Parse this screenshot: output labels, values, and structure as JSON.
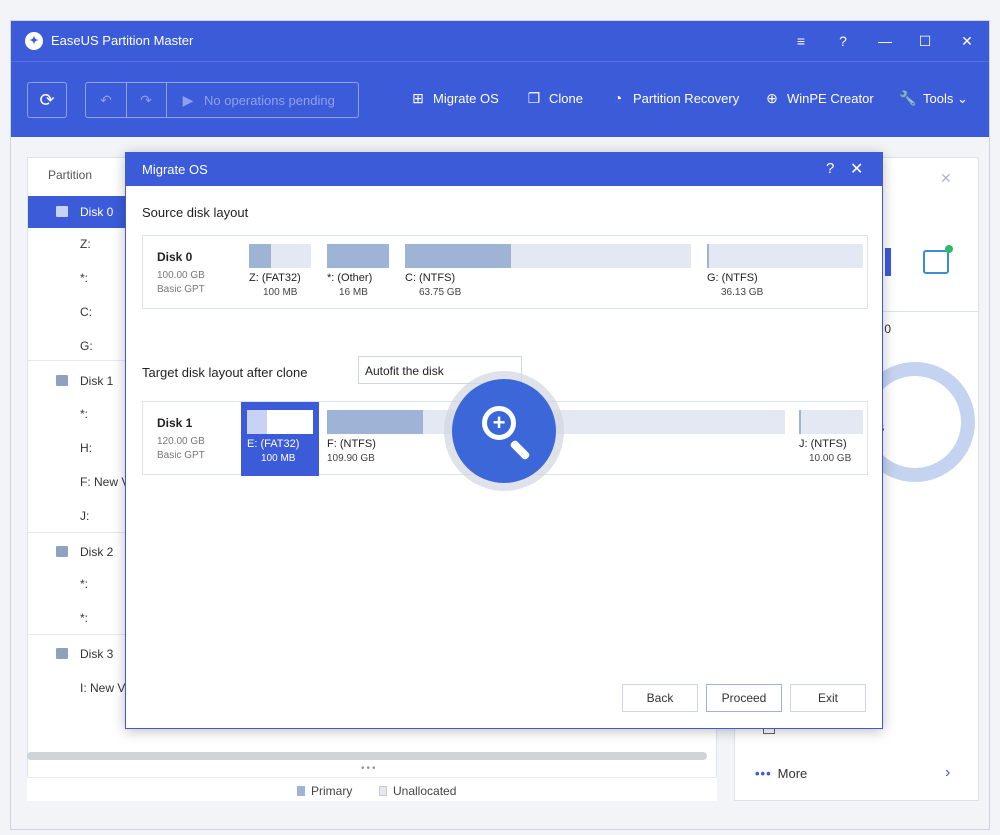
{
  "app": {
    "title": "EaseUS Partition Master"
  },
  "window_controls": {
    "menu": "≡",
    "help": "?",
    "minimize": "—",
    "maximize": "☐",
    "close": "✕"
  },
  "toolbar": {
    "pending_text": "No operations pending",
    "tools": [
      {
        "label": "Migrate OS",
        "icon": "windows-icon"
      },
      {
        "label": "Clone",
        "icon": "clone-icon"
      },
      {
        "label": "Partition Recovery",
        "icon": "pie-icon"
      },
      {
        "label": "WinPE Creator",
        "icon": "lifebuoy-icon"
      },
      {
        "label": "Tools",
        "icon": "wrench-icon"
      }
    ]
  },
  "left_panel": {
    "header": "Partition",
    "rows": [
      {
        "kind": "disk",
        "label": "Disk 0",
        "selected": true
      },
      {
        "kind": "part",
        "label": "Z:"
      },
      {
        "kind": "part",
        "label": "*:"
      },
      {
        "kind": "part",
        "label": "C:"
      },
      {
        "kind": "part",
        "label": "G:"
      },
      {
        "kind": "disk",
        "label": "Disk 1"
      },
      {
        "kind": "part",
        "label": "*:"
      },
      {
        "kind": "part",
        "label": "H:"
      },
      {
        "kind": "part",
        "label": "F: New V"
      },
      {
        "kind": "part",
        "label": "J:"
      },
      {
        "kind": "disk",
        "label": "Disk 2"
      },
      {
        "kind": "part",
        "label": "*:"
      },
      {
        "kind": "part",
        "label": "*:"
      },
      {
        "kind": "disk",
        "label": "Disk 3"
      },
      {
        "kind": "part",
        "label": "I: New V"
      }
    ]
  },
  "legend": {
    "primary": "Primary",
    "unallocated": "Unallocated"
  },
  "right_panel": {
    "disk_label": "k 0",
    "size_suffix": "B",
    "text_t": "t",
    "more": "More"
  },
  "dialog": {
    "title": "Migrate OS",
    "source_title": "Source disk layout",
    "target_title": "Target disk layout after clone",
    "autofit_value": "Autofit the disk",
    "source_disk": {
      "name": "Disk 0",
      "size": "100.00 GB",
      "type": "Basic GPT",
      "partitions": [
        {
          "name": "Z: (FAT32)",
          "size": "100 MB",
          "used": 0.35
        },
        {
          "name": "*: (Other)",
          "size": "16 MB",
          "used": 1.0
        },
        {
          "name": "C: (NTFS)",
          "size": "63.75 GB",
          "used": 0.37
        },
        {
          "name": "G: (NTFS)",
          "size": "36.13 GB",
          "used": 0.01
        }
      ]
    },
    "target_disk": {
      "name": "Disk 1",
      "size": "120.00 GB",
      "type": "Basic GPT",
      "partitions": [
        {
          "name": "E: (FAT32)",
          "size": "100 MB",
          "used": 0.3
        },
        {
          "name": "F: (NTFS)",
          "size": "109.90 GB",
          "used": 0.21
        },
        {
          "name": "J: (NTFS)",
          "size": "10.00 GB",
          "used": 0.03
        }
      ]
    },
    "buttons": {
      "back": "Back",
      "proceed": "Proceed",
      "exit": "Exit"
    }
  },
  "colors": {
    "accent": "#3b5bd9",
    "partition_fill": "#9fb3d6",
    "partition_bar": "#e3e8f2"
  }
}
